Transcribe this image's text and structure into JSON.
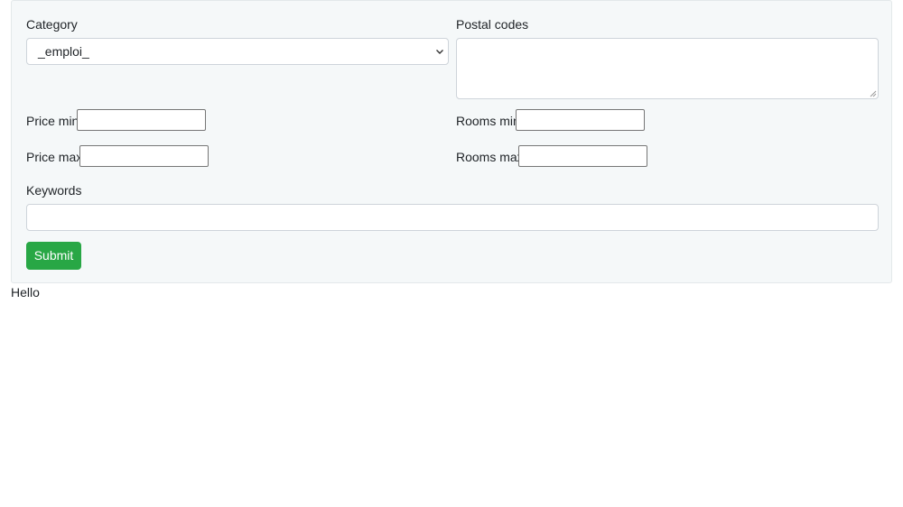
{
  "form": {
    "category_label": "Category",
    "category_selected": "_emploi_",
    "postal_codes_label": "Postal codes",
    "price_min_label": "Price min",
    "price_max_label": "Price max",
    "rooms_min_label": "Rooms min",
    "rooms_max_label": "Rooms max",
    "keywords_label": "Keywords",
    "submit_label": "Submit"
  },
  "footer_text": "Hello",
  "colors": {
    "panel_bg": "#f5f8f9",
    "submit_bg": "#28a745",
    "submit_text": "#ffffff"
  },
  "icons": {
    "select_chevron": "chevron-down-icon",
    "textarea_grip": "resize-grip-icon"
  }
}
